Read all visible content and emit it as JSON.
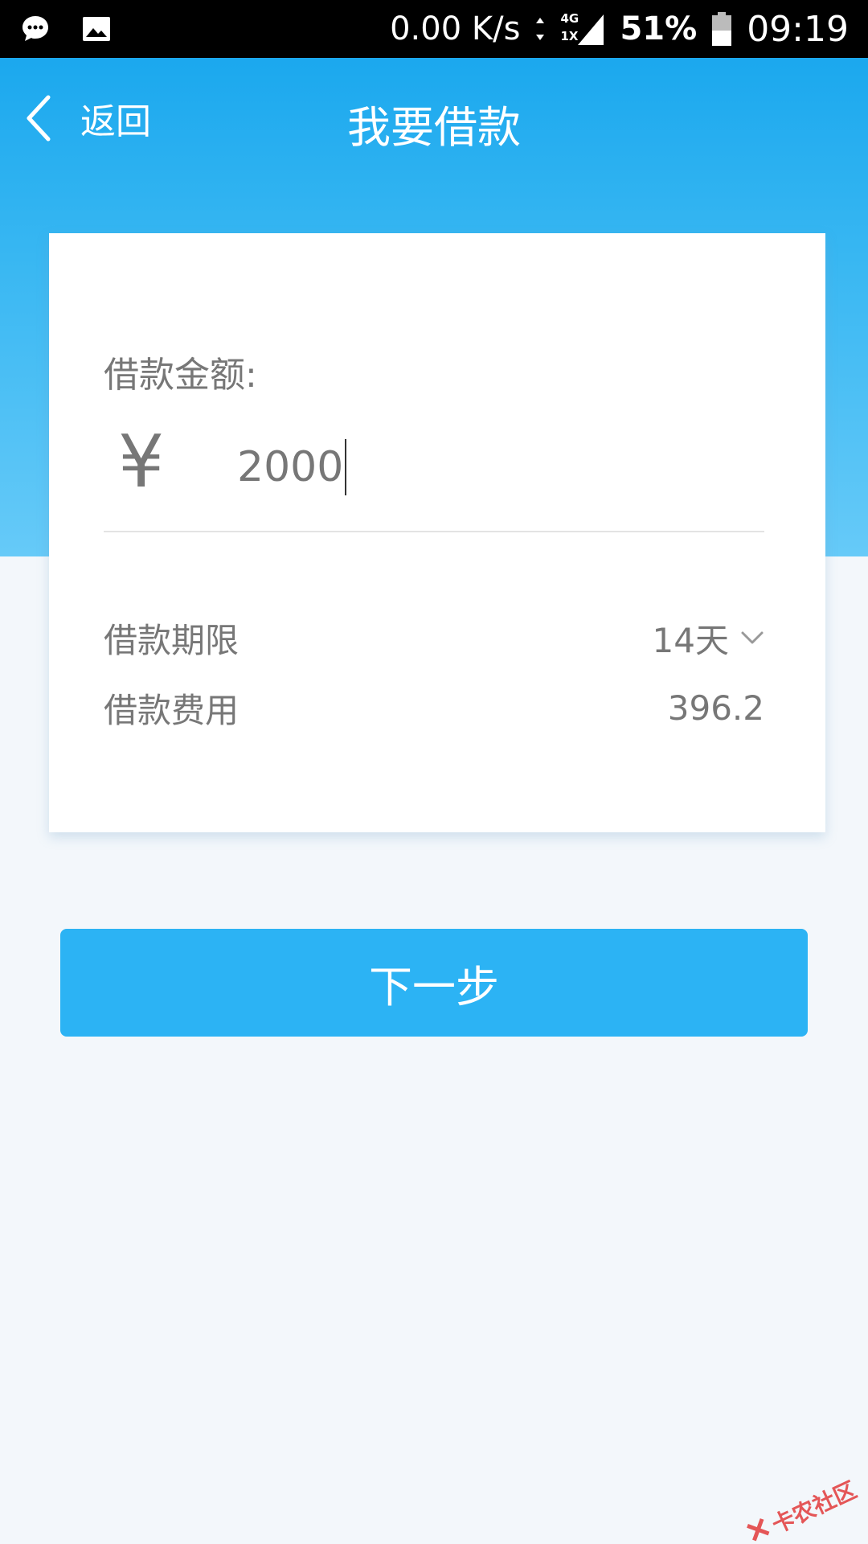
{
  "status_bar": {
    "network_speed": "0.00 K/s",
    "network_type_top": "4G",
    "network_type_bottom": "1X",
    "battery_percent": "51%",
    "time": "09:19",
    "icons": [
      "message-icon",
      "image-icon",
      "data-arrows-icon",
      "signal-icon",
      "battery-icon"
    ]
  },
  "header": {
    "back_label": "返回",
    "title": "我要借款",
    "color": "#1ba8ee"
  },
  "form": {
    "amount_label": "借款金额:",
    "currency_symbol": "¥",
    "amount_value": "2000",
    "term_label": "借款期限",
    "term_value": "14天",
    "fee_label": "借款费用",
    "fee_value": "396.2"
  },
  "actions": {
    "next_label": "下一步",
    "button_color": "#2cb3f4"
  },
  "watermark": {
    "text": "卡农社区"
  }
}
